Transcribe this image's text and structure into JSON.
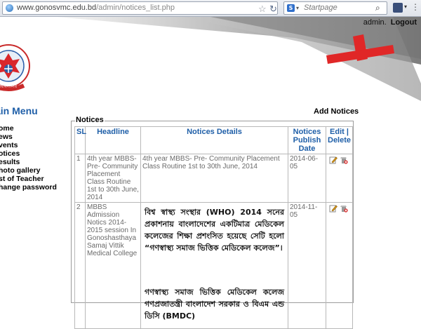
{
  "browser": {
    "url_host": "www.gonosvmc.edu.bd",
    "url_path": "/admin/notices_list.php",
    "search_placeholder": "Startpage"
  },
  "header": {
    "user": "admin.",
    "logout_label": "Logout"
  },
  "sidebar": {
    "title": "ain Menu",
    "items": [
      {
        "label": "ome"
      },
      {
        "label": "ews"
      },
      {
        "label": "vents"
      },
      {
        "label": "otices"
      },
      {
        "label": "esults"
      },
      {
        "label": "hoto gallery"
      },
      {
        "label": "st of Teacher"
      },
      {
        "label": "hange password"
      }
    ]
  },
  "main": {
    "add_notices_label": "Add Notices",
    "legend": "Notices",
    "columns": {
      "sl": "SL",
      "headline": "Headline",
      "details": "Notices Details",
      "date": "Notices Publish Date",
      "actions": "Edit | Delete"
    },
    "rows": [
      {
        "sl": "1",
        "headline": "4th year MBBS- Pre- Community Placement Class Routine 1st to 30th June, 2014",
        "details": "4th year MBBS- Pre- Community Placement Class Routine 1st to 30th June, 2014",
        "date": "2014-06-05"
      },
      {
        "sl": "2",
        "headline": "MBBS Admission Notics 2014-2015 session In Gonoshasthaya Samaj Vittik Medical College",
        "details_para1": "বিশ্ব স্বাস্থ্য সংস্থার (WHO) 2014 সনের প্রকাশনায় বাংলাদেশের একটিমাত্র মেডিকেল কলেজের শিক্ষা প্রশংসিত হয়েছে সেটি হলো “গণস্বাস্থ্য সমাজ ভিত্তিক মেডিকেল কলেজ”।",
        "details_para2": "গণস্বাস্থ্য সমাজ ভিত্তিক মেডিকেল কলেজ গণপ্রজাতন্ত্রী বাংলাদেশ সরকার ও বিএম এন্ড ডিসি (BMDC)",
        "date": "2014-11-05"
      }
    ]
  },
  "colors": {
    "heading_blue": "#1f5fa8",
    "logo_red": "#d9262b",
    "banner_gray": "#8e8e8e"
  }
}
